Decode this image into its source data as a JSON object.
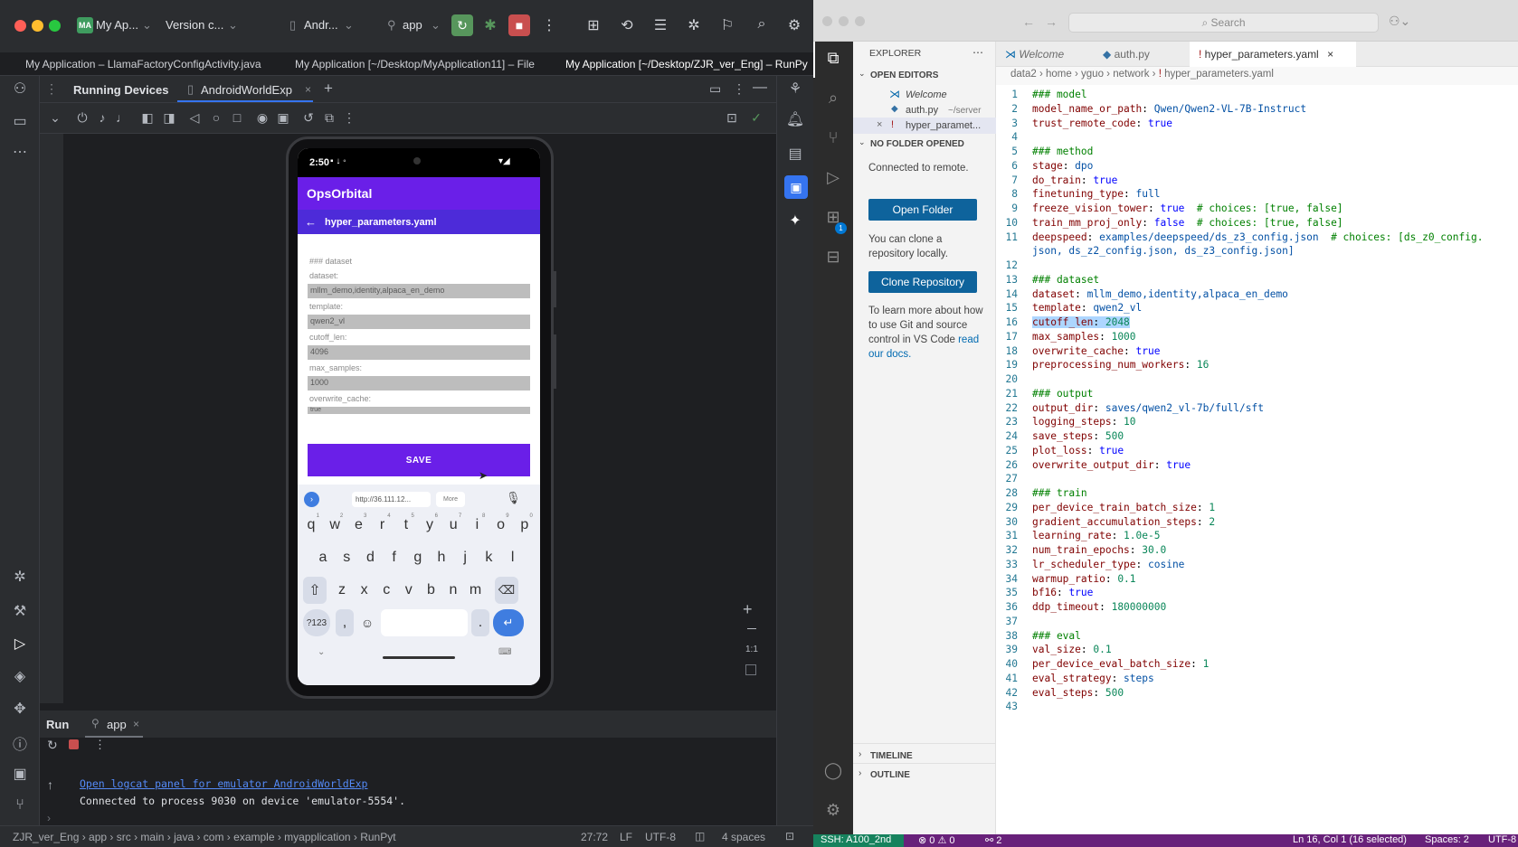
{
  "as": {
    "title": {
      "project_badge": "MA",
      "project": "My Ap...",
      "vcs": "Version c...",
      "device": "Andr...",
      "run_config": "app"
    },
    "window_tabs": [
      "My Application – LlamaFactoryConfigActivity.java",
      "My Application [~/Desktop/MyApplication11] – File",
      "My Application [~/Desktop/ZJR_ver_Eng] – RunPy"
    ],
    "panel": {
      "title": "Running Devices",
      "device_tab": "AndroidWorldExp"
    },
    "phone": {
      "status_time": "2:50",
      "app_title": "OpsOrbital",
      "file_title": "hyper_parameters.yaml",
      "section": "### dataset",
      "fields": [
        {
          "label": "dataset:",
          "value": "mllm_demo,identity,alpaca_en_demo"
        },
        {
          "label": "template:",
          "value": "qwen2_vl"
        },
        {
          "label": "cutoff_len:",
          "value": "4096"
        },
        {
          "label": "max_samples:",
          "value": "1000"
        },
        {
          "label": "overwrite_cache:",
          "value": "true"
        }
      ],
      "save": "SAVE",
      "clip_url": "http://36.111.12...",
      "clip_more": "More",
      "kb_row1": [
        "q",
        "w",
        "e",
        "r",
        "t",
        "y",
        "u",
        "i",
        "o",
        "p"
      ],
      "kb_row1_hints": [
        "1",
        "2",
        "3",
        "4",
        "5",
        "6",
        "7",
        "8",
        "9",
        "0"
      ],
      "kb_row2": [
        "a",
        "s",
        "d",
        "f",
        "g",
        "h",
        "j",
        "k",
        "l"
      ],
      "kb_row3": [
        "z",
        "x",
        "c",
        "v",
        "b",
        "n",
        "m"
      ],
      "kb_sym": "?123",
      "kb_comma": ",",
      "kb_period": "."
    },
    "zoom_ratio": "1:1",
    "run": {
      "tab_run": "Run",
      "tab_app": "app",
      "log_link": "Open logcat panel for emulator AndroidWorldExp",
      "log_line": "Connected to process 9030 on device 'emulator-5554'."
    },
    "status": {
      "crumbs": [
        "ZJR_ver_Eng",
        "app",
        "src",
        "main",
        "java",
        "com",
        "example",
        "myapplication",
        "RunPyt"
      ],
      "pos": "27:72",
      "eol": "LF",
      "enc": "UTF-8",
      "indent": "4 spaces"
    }
  },
  "vs": {
    "search": "Search",
    "explorer": "EXPLORER",
    "open_editors": "OPEN EDITORS",
    "editors": [
      {
        "name": "Welcome",
        "detail": ""
      },
      {
        "name": "auth.py",
        "detail": "~/server"
      },
      {
        "name": "hyper_paramet...",
        "detail": ""
      }
    ],
    "no_folder": "NO FOLDER OPENED",
    "connected": "Connected to remote.",
    "open_folder": "Open Folder",
    "clone_msg": "You can clone a repository locally.",
    "clone_btn": "Clone Repository",
    "learn_msg": "To learn more about how to use Git and source control in VS Code",
    "learn_link": "read our docs.",
    "timeline": "TIMELINE",
    "outline": "OUTLINE",
    "tabs": [
      "Welcome",
      "auth.py",
      "hyper_parameters.yaml"
    ],
    "breadcrumb": [
      "data2",
      "home",
      "yguo",
      "network",
      "hyper_parameters.yaml"
    ],
    "scm_badge": "1",
    "status": {
      "remote": "SSH: A100_2nd",
      "problems": "0 ⚠ 0",
      "ports": "2",
      "cursor": "Ln 16, Col 1 (16 selected)",
      "spaces": "Spaces: 2",
      "enc": "UTF-8"
    },
    "code": [
      "### model",
      "model_name_or_path: Qwen/Qwen2-VL-7B-Instruct",
      "trust_remote_code: true",
      "",
      "### method",
      "stage: dpo",
      "do_train: true",
      "finetuning_type: full",
      "freeze_vision_tower: true  # choices: [true, false]",
      "train_mm_proj_only: false  # choices: [true, false]",
      "deepspeed: examples/deepspeed/ds_z3_config.json  # choices: [ds_z0_config.",
      "json, ds_z2_config.json, ds_z3_config.json]",
      "",
      "### dataset",
      "dataset: mllm_demo,identity,alpaca_en_demo",
      "template: qwen2_vl",
      "cutoff_len: 2048",
      "max_samples: 1000",
      "overwrite_cache: true",
      "preprocessing_num_workers: 16",
      "",
      "### output",
      "output_dir: saves/qwen2_vl-7b/full/sft",
      "logging_steps: 10",
      "save_steps: 500",
      "plot_loss: true",
      "overwrite_output_dir: true",
      "",
      "### train",
      "per_device_train_batch_size: 1",
      "gradient_accumulation_steps: 2",
      "learning_rate: 1.0e-5",
      "num_train_epochs: 30.0",
      "lr_scheduler_type: cosine",
      "warmup_ratio: 0.1",
      "bf16: true",
      "ddp_timeout: 180000000",
      "",
      "### eval",
      "val_size: 0.1",
      "per_device_eval_batch_size: 1",
      "eval_strategy: steps",
      "eval_steps: 500",
      ""
    ],
    "line_numbers": [
      "1",
      "2",
      "3",
      "4",
      "5",
      "6",
      "7",
      "8",
      "9",
      "10",
      "11",
      "",
      "12",
      "13",
      "14",
      "15",
      "16",
      "17",
      "18",
      "19",
      "20",
      "21",
      "22",
      "23",
      "24",
      "25",
      "26",
      "27",
      "28",
      "29",
      "30",
      "31",
      "32",
      "33",
      "34",
      "35",
      "36",
      "37",
      "38",
      "39",
      "40",
      "41",
      "42",
      "43"
    ]
  }
}
